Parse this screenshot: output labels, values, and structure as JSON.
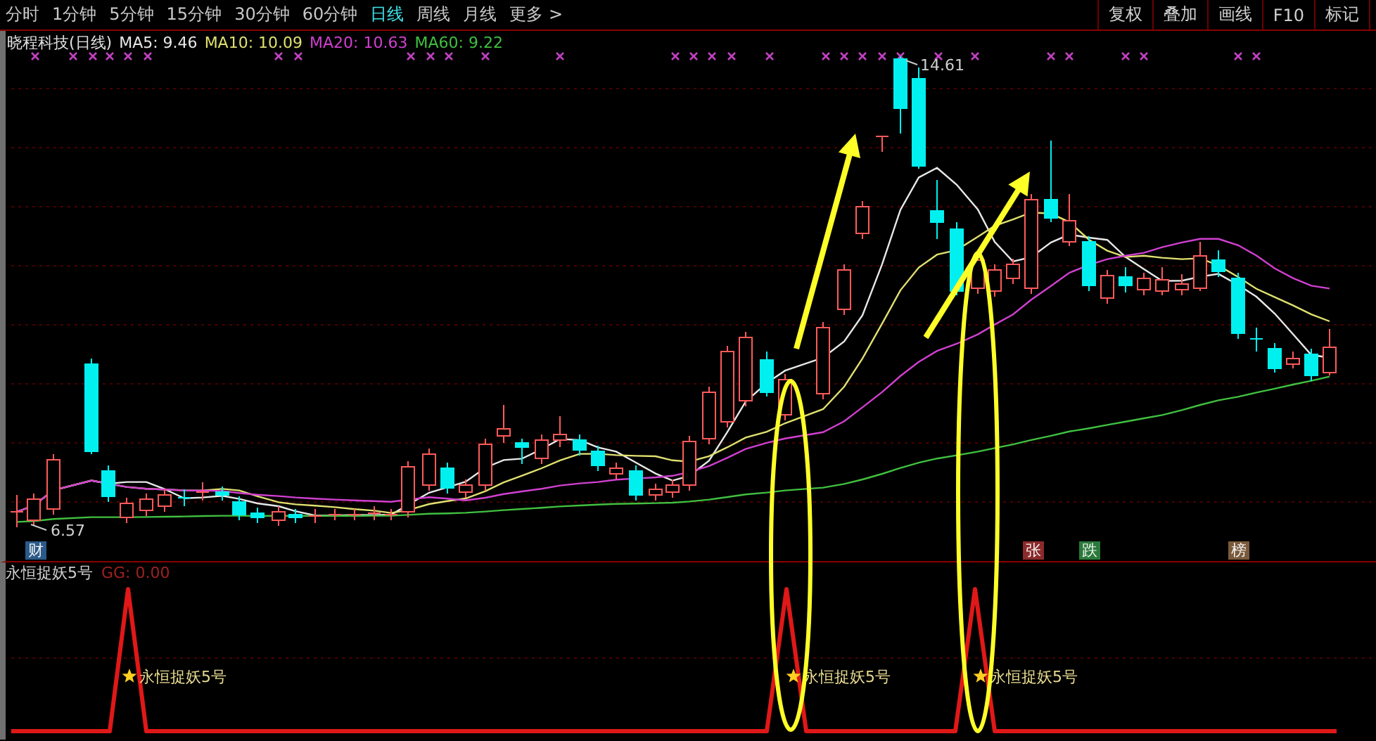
{
  "toolbar": {
    "periods": [
      {
        "label": "分时",
        "selected": false
      },
      {
        "label": "1分钟",
        "selected": false
      },
      {
        "label": "5分钟",
        "selected": false
      },
      {
        "label": "15分钟",
        "selected": false
      },
      {
        "label": "30分钟",
        "selected": false
      },
      {
        "label": "60分钟",
        "selected": false
      },
      {
        "label": "日线",
        "selected": true
      },
      {
        "label": "周线",
        "selected": false
      },
      {
        "label": "月线",
        "selected": false
      },
      {
        "label": "更多 >",
        "selected": false
      }
    ],
    "actions": [
      "复权",
      "叠加",
      "画线",
      "F10",
      "标记"
    ]
  },
  "price_chart": {
    "stock_title": "晓程科技(日线)",
    "averages": [
      {
        "label": "MA5: 9.46",
        "color": "#e8e8e8"
      },
      {
        "label": "MA10: 10.09",
        "color": "#e0e070"
      },
      {
        "label": "MA20: 10.63",
        "color": "#d040d0"
      },
      {
        "label": "MA60: 9.22",
        "color": "#40c040"
      }
    ],
    "high_label": "14.61",
    "low_label": "6.57",
    "badges": [
      {
        "label": "财",
        "color": "#2a5a8a"
      },
      {
        "label": "张",
        "color": "#8a2a2a"
      },
      {
        "label": "跌",
        "color": "#2a7a3a"
      },
      {
        "label": "榜",
        "color": "#7a5a3a"
      }
    ]
  },
  "indicator": {
    "title": "永恒捉妖5号",
    "value": "GG: 0.00",
    "signals": [
      "永恒捉妖5号",
      "永恒捉妖5号",
      "永恒捉妖5号"
    ]
  }
}
